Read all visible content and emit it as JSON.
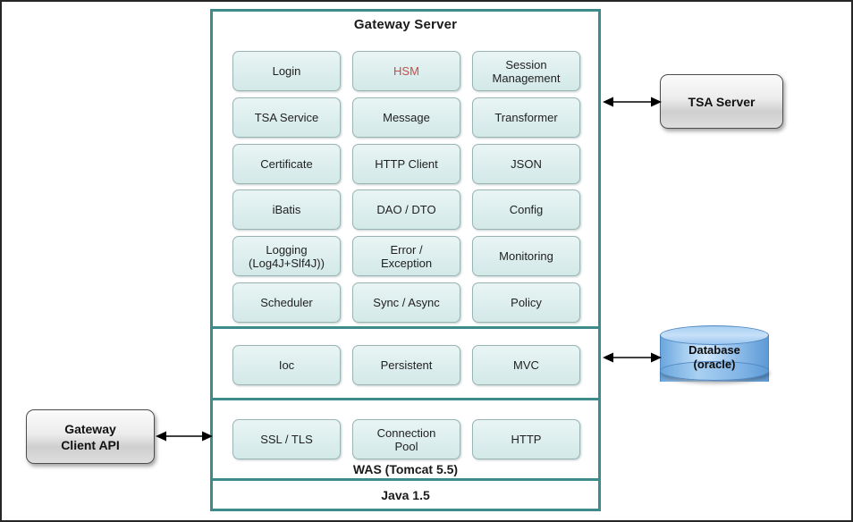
{
  "diagram": {
    "title": "Gateway Server",
    "sections": {
      "application": {
        "rows": [
          [
            "Login",
            "HSM",
            "Session\nManagement"
          ],
          [
            "TSA Service",
            "Message",
            "Transformer"
          ],
          [
            "Certificate",
            "HTTP Client",
            "JSON"
          ],
          [
            "iBatis",
            "DAO / DTO",
            "Config"
          ],
          [
            "Logging\n(Log4J+Slf4J))",
            "Error /\nException",
            "Monitoring"
          ],
          [
            "Scheduler",
            "Sync / Async",
            "Policy"
          ]
        ]
      },
      "framework": {
        "rows": [
          [
            "Ioc",
            "Persistent",
            "MVC"
          ]
        ]
      },
      "was": {
        "label": "WAS (Tomcat 5.5)",
        "rows": [
          [
            "SSL / TLS",
            "Connection\nPool",
            "HTTP"
          ]
        ]
      },
      "platform": {
        "label": "Java 1.5"
      }
    },
    "cells": {
      "login": "Login",
      "hsm": "HSM",
      "session_management": "Session\nManagement",
      "tsa_service": "TSA Service",
      "message": "Message",
      "transformer": "Transformer",
      "certificate": "Certificate",
      "http_client": "HTTP Client",
      "json": "JSON",
      "ibatis": "iBatis",
      "dao_dto": "DAO / DTO",
      "config": "Config",
      "logging": "Logging\n(Log4J+Slf4J))",
      "error_exception": "Error /\nException",
      "monitoring": "Monitoring",
      "scheduler": "Scheduler",
      "sync_async": "Sync / Async",
      "policy": "Policy",
      "ioc": "Ioc",
      "persistent": "Persistent",
      "mvc": "MVC",
      "ssl_tls": "SSL / TLS",
      "connection_pool": "Connection\nPool",
      "http": "HTTP"
    },
    "external": {
      "tsa_server": "TSA Server",
      "database": "Database\n(oracle)",
      "gateway_client_api": "Gateway\nClient API"
    },
    "connectors": [
      {
        "name": "gateway-to-tsa-server",
        "kind": "double-arrow"
      },
      {
        "name": "gateway-to-database",
        "kind": "double-arrow"
      },
      {
        "name": "gateway-client-to-gateway",
        "kind": "double-arrow"
      }
    ],
    "colors": {
      "frame_border": "#3e8b8b",
      "cell_fill": "#dceeed",
      "cell_border": "#9ab4b4",
      "accent_text": "#c0504d",
      "external_fill": "#ececec",
      "database_fill": "#8dbce9",
      "page_border": "#262626"
    }
  }
}
